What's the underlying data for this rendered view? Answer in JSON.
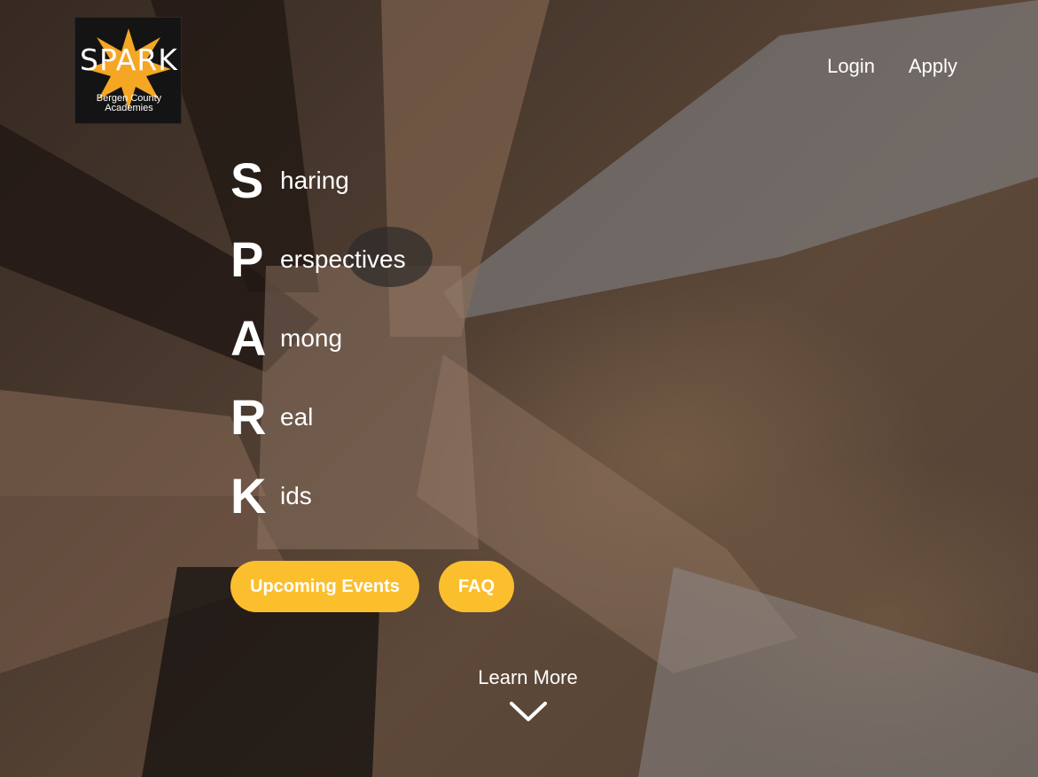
{
  "logo": {
    "wordmark": "SPARK",
    "line1": "Bergen County",
    "line2": "Academies",
    "burst_color": "#f5a623"
  },
  "nav": {
    "login": "Login",
    "apply": "Apply"
  },
  "acronym": [
    {
      "letter": "S",
      "rest": "haring"
    },
    {
      "letter": "P",
      "rest": "erspectives"
    },
    {
      "letter": "A",
      "rest": "mong"
    },
    {
      "letter": "R",
      "rest": "eal"
    },
    {
      "letter": "K",
      "rest": "ids"
    }
  ],
  "buttons": {
    "events": "Upcoming Events",
    "faq": "FAQ",
    "color": "#fbbf2e"
  },
  "learn_more": {
    "label": "Learn More",
    "icon": "chevron-down-icon"
  }
}
